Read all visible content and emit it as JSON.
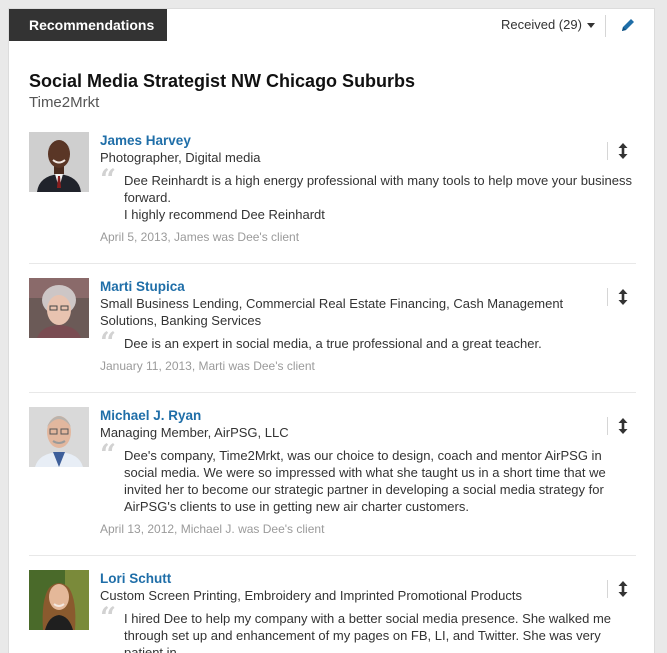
{
  "header": {
    "tab_label": "Recommendations",
    "received_label": "Received (29)"
  },
  "position": {
    "title": "Social Media Strategist NW Chicago Suburbs",
    "company": "Time2Mrkt"
  },
  "recommendations": [
    {
      "name": "James Harvey",
      "headline": "Photographer, Digital media",
      "quote": "Dee Reinhardt is a high energy professional with many tools to help move your business forward.\nI highly recommend Dee Reinhardt",
      "date": "April 5, 2013, James was Dee's client"
    },
    {
      "name": "Marti Stupica",
      "headline": "Small Business Lending, Commercial Real Estate Financing, Cash Management Solutions, Banking Services",
      "quote": "Dee is an expert in social media, a true professional and a great teacher.",
      "date": "January 11, 2013, Marti was Dee's client"
    },
    {
      "name": "Michael J. Ryan",
      "headline": "Managing Member, AirPSG, LLC",
      "quote": "Dee's company, Time2Mrkt, was our choice to design, coach and mentor AirPSG in social media. We were so impressed with what she taught us in a short time that we invited her to become our strategic partner in developing a social media strategy for AirPSG's clients to use in getting new air charter customers.",
      "date": "April 13, 2012, Michael J. was Dee's client"
    },
    {
      "name": "Lori Schutt",
      "headline": "Custom Screen Printing, Embroidery and Imprinted Promotional Products",
      "quote": "I hired Dee to help my company with a better social media presence. She walked me through set up and enhancement of my pages on FB, LI, and Twitter. She was very patient in",
      "date": ""
    }
  ],
  "icons": {
    "dropdown": "caret-down-icon",
    "edit": "pencil-icon",
    "reorder": "up-down-arrow-icon",
    "quote": "quote-mark-icon"
  },
  "colors": {
    "tab_bg": "#333333",
    "link": "#1f6ea8",
    "edit_icon": "#1f6ea8",
    "meta_text": "#9a9a9a"
  }
}
